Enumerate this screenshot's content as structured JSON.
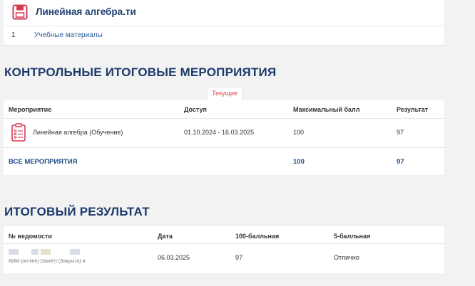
{
  "course": {
    "title": "Линейная алгебра.ти",
    "row_number": "1",
    "materials_link": "Учебные материалы"
  },
  "events_section": {
    "title": "КОНТРОЛЬНЫЕ ИТОГОВЫЕ МЕРОПРИЯТИЯ",
    "tab_label": "Текущие",
    "columns": [
      "Мероприятие",
      "Доступ",
      "Максимальный балл",
      "Результат"
    ],
    "rows": [
      {
        "name": "Линейная алгебра (Обучение)",
        "access": "01.10.2024 - 16.03.2025",
        "max_score": "100",
        "result": "97"
      }
    ],
    "total": {
      "label": "ВСЕ МЕРОПРИЯТИЯ",
      "max_score": "100",
      "result": "97"
    }
  },
  "results_section": {
    "title": "ИТОГОВЫЙ РЕЗУЛЬТАТ",
    "columns": [
      "№ ведомости",
      "Дата",
      "100-балльная",
      "5-балльная"
    ],
    "rows": [
      {
        "statement_text": "КИМ (on-line) (Зачёт) (Закрыта) и",
        "date": "06.03.2025",
        "score_100": "97",
        "score_5": "Отлично"
      }
    ]
  },
  "colors": {
    "accent_red": "#d43a52",
    "heading_blue": "#1b3a6b",
    "link_blue": "#2d5f9a"
  },
  "icons": {
    "course": "floppy-disk-icon",
    "event": "clipboard-checklist-icon"
  }
}
